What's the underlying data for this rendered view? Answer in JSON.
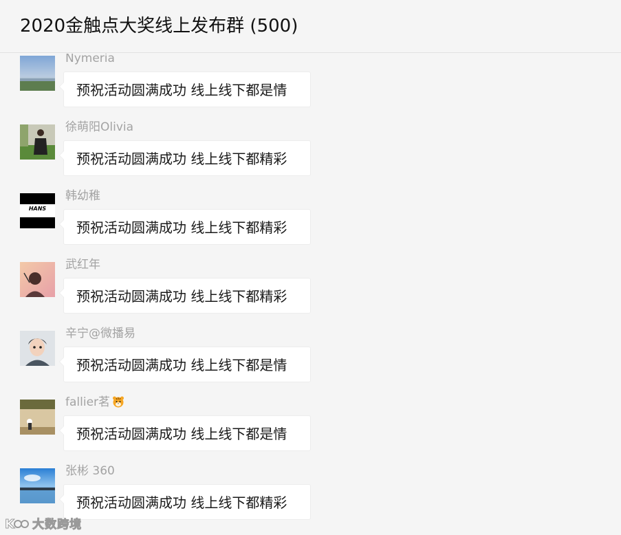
{
  "header": {
    "title": "2020金触点大奖线上发布群 (500)"
  },
  "messages": [
    {
      "sender": "Nymeria",
      "text": "预祝活动圆满成功  线上线下都是情",
      "avatar": "landscape-avatar"
    },
    {
      "sender": "徐萌阳Olivia",
      "text": "预祝活动圆满成功  线上线下都精彩",
      "avatar": "person-field-avatar"
    },
    {
      "sender": "韩幼稚",
      "text": "预祝活动圆满成功  线上线下都精彩",
      "avatar": "hans-logo-avatar",
      "avatar_label": "HANS"
    },
    {
      "sender": "武红年",
      "text": "预祝活动圆满成功  线上线下都精彩",
      "avatar": "portrait-sunset-avatar"
    },
    {
      "sender": "辛宁@微播易",
      "text": "预祝活动圆满成功  线上线下都是情",
      "avatar": "cartoon-avatar"
    },
    {
      "sender": "fallier茗",
      "emoji": "tiger-emoji",
      "text": "预祝活动圆满成功  线上线下都是情",
      "avatar": "photo-avatar"
    },
    {
      "sender": "张彬 360",
      "text": "预祝活动圆满成功  线上线下都精彩",
      "avatar": "sky-lake-avatar"
    }
  ],
  "watermark": {
    "text": "大数跨境"
  }
}
